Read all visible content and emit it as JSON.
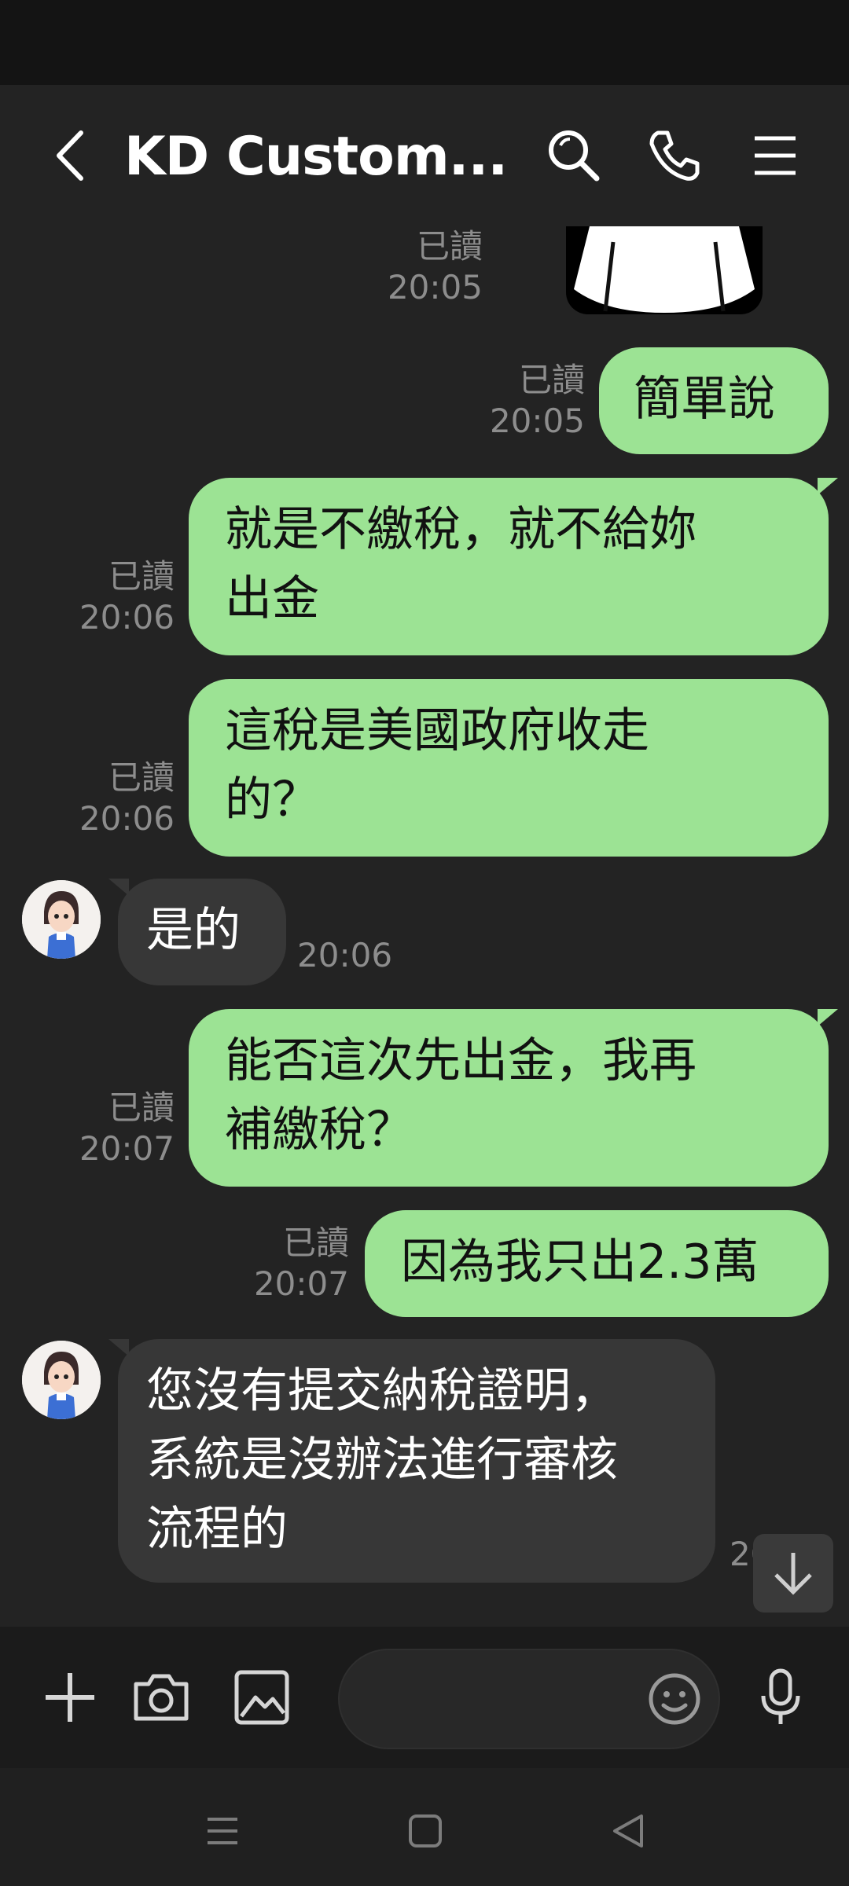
{
  "header": {
    "title": "KD Custom...",
    "back_icon": "chevron-left-icon",
    "search_icon": "search-icon",
    "call_icon": "phone-icon",
    "menu_icon": "menu-icon"
  },
  "messages": [
    {
      "direction": "out",
      "type": "image",
      "read": "已讀",
      "time": "20:05"
    },
    {
      "direction": "out",
      "text": "簡單說",
      "read": "已讀",
      "time": "20:05"
    },
    {
      "direction": "out",
      "lines": [
        "就是不繳稅，就不給妳",
        "出金"
      ],
      "read": "已讀",
      "time": "20:06"
    },
    {
      "direction": "out",
      "lines": [
        "這稅是美國政府收走",
        "的？"
      ],
      "read": "已讀",
      "time": "20:06"
    },
    {
      "direction": "in",
      "text": "是的",
      "time": "20:06"
    },
    {
      "direction": "out",
      "lines": [
        "能否這次先出金，我再",
        "補繳稅？"
      ],
      "read": "已讀",
      "time": "20:07"
    },
    {
      "direction": "out",
      "text": "因為我只出2.3萬",
      "read": "已讀",
      "time": "20:07"
    },
    {
      "direction": "in",
      "lines": [
        "您沒有提交納稅證明，",
        "系統是沒辦法進行審核",
        "流程的"
      ],
      "time": "20:"
    }
  ],
  "composer": {
    "placeholder": "",
    "add_icon": "plus-icon",
    "camera_icon": "camera-icon",
    "gallery_icon": "image-icon",
    "emoji_icon": "emoji-icon",
    "mic_icon": "microphone-icon"
  },
  "colors": {
    "outgoing": "#9ce394",
    "incoming": "#373737",
    "background": "#232323"
  }
}
